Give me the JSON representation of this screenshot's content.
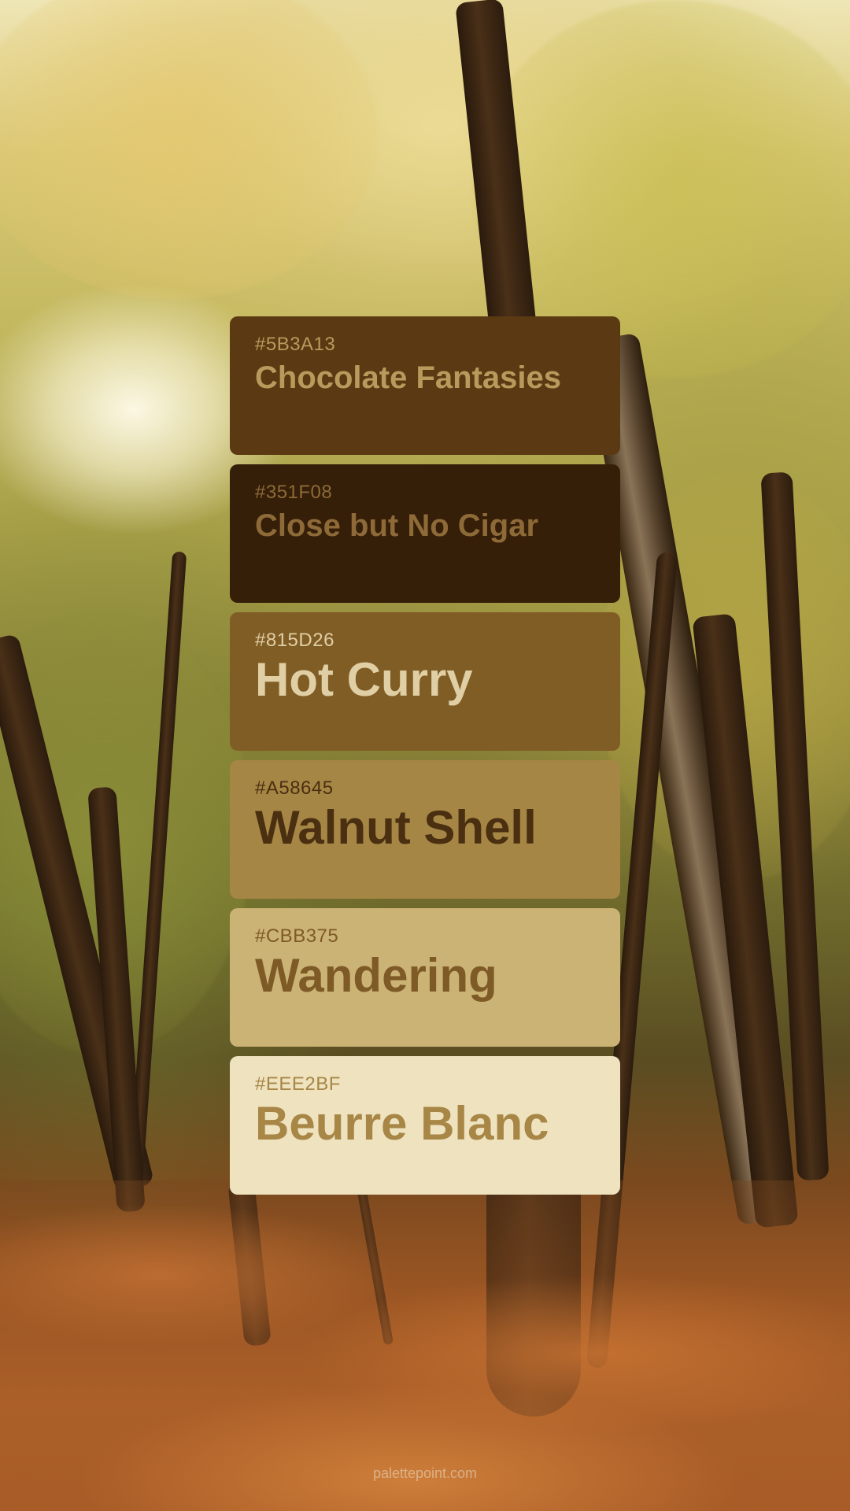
{
  "palette": [
    {
      "hex": "#5B3A13",
      "name": "Chocolate Fantasies",
      "bg": "#5B3A13",
      "text_color": "#B89A5C",
      "size": "small"
    },
    {
      "hex": "#351F08",
      "name": "Close but No Cigar",
      "bg": "#351F08",
      "text_color": "#8E6A38",
      "size": "small"
    },
    {
      "hex": "#815D26",
      "name": "Hot Curry",
      "bg": "#815D26",
      "text_color": "#E0CFA5",
      "size": "big"
    },
    {
      "hex": "#A58645",
      "name": "Walnut Shell",
      "bg": "#A58645",
      "text_color": "#4A2F10",
      "size": "big"
    },
    {
      "hex": "#CBB375",
      "name": "Wandering",
      "bg": "#CBB375",
      "text_color": "#7E5A26",
      "size": "big"
    },
    {
      "hex": "#EEE2BF",
      "name": "Beurre Blanc",
      "bg": "#EEE2BF",
      "text_color": "#A78646",
      "size": "big"
    }
  ],
  "footer": {
    "text": "palettepoint.com"
  }
}
